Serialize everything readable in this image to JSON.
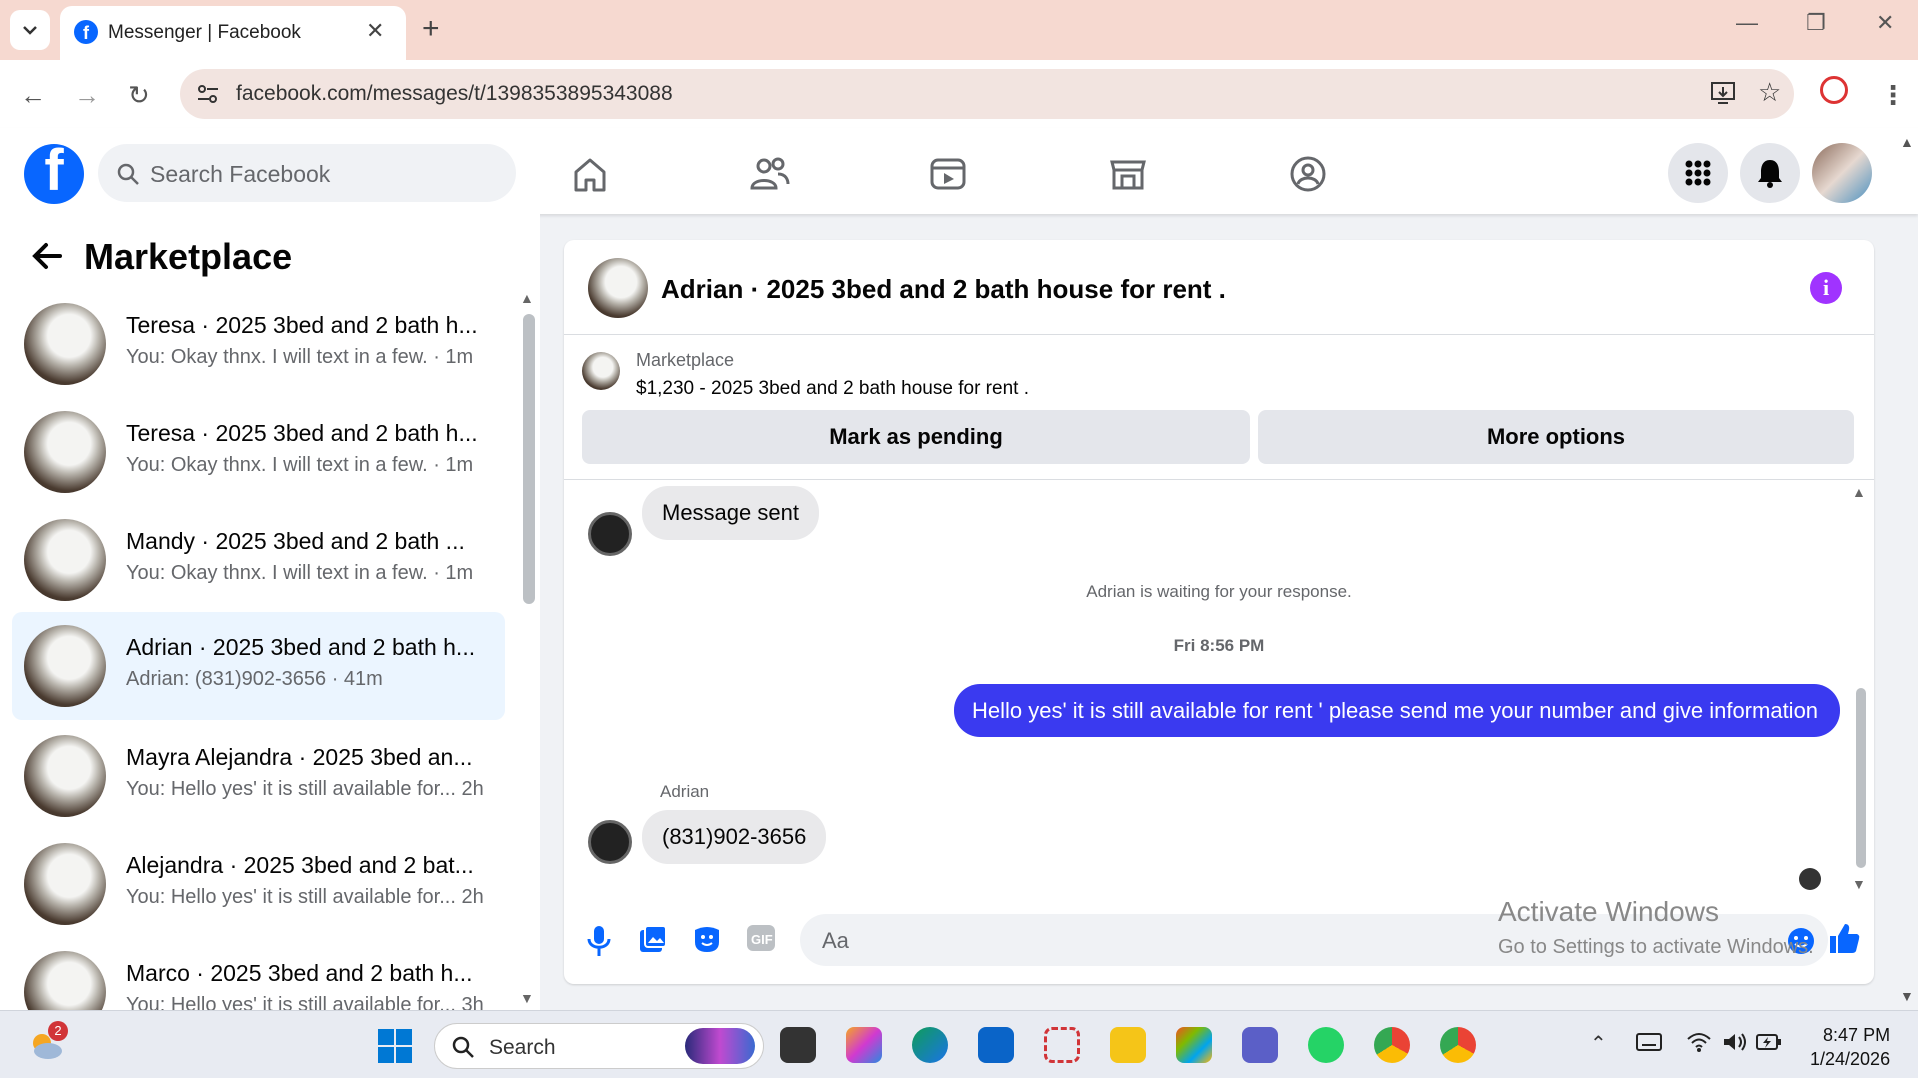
{
  "browser": {
    "tab_title": "Messenger | Facebook",
    "url": "facebook.com/messages/t/1398353895343088"
  },
  "facebook": {
    "search_placeholder": "Search Facebook",
    "brand_color": "#0866ff"
  },
  "sidebar": {
    "title": "Marketplace",
    "conversations": [
      {
        "name": "Teresa · 2025 3bed and 2 bath h...",
        "snippet": "You: Okay thnx. I will text in a few. · 1m"
      },
      {
        "name": "Teresa · 2025 3bed and 2 bath h...",
        "snippet": "You: Okay thnx. I will text in a few. · 1m"
      },
      {
        "name": "Mandy · 2025 3bed and 2 bath ...",
        "snippet": "You: Okay thnx. I will text in a few. · 1m"
      },
      {
        "name": "Adrian · 2025 3bed and 2 bath h...",
        "snippet": "Adrian: (831)902-3656 · 41m"
      },
      {
        "name": "Mayra Alejandra · 2025 3bed an...",
        "snippet": "You: Hello yes' it is still available for...  2h"
      },
      {
        "name": "Alejandra · 2025 3bed and 2 bat...",
        "snippet": "You: Hello yes' it is still available for...  2h"
      },
      {
        "name": "Marco · 2025 3bed and 2 bath h...",
        "snippet": "You: Hello yes' it is still available for...  3h"
      }
    ]
  },
  "chat": {
    "title": "Adrian · 2025 3bed and 2 bath house for rent .",
    "listing_label": "Marketplace",
    "listing_price_title": "$1,230 - 2025 3bed and 2 bath house for rent .",
    "mark_pending_label": "Mark as pending",
    "more_options_label": "More options",
    "msg_sent": "Message sent",
    "waiting_notice": "Adrian is waiting for your response.",
    "timestamp": "Fri 8:56 PM",
    "outgoing": "Hello yes' it is still available for rent ' please send me your number and give information",
    "sender_name": "Adrian",
    "incoming": "(831)902-3656",
    "input_placeholder": "Aa",
    "outgoing_color": "#3a3af0"
  },
  "watermark": {
    "line1": "Activate Windows",
    "line2": "Go to Settings to activate Windows."
  },
  "taskbar": {
    "search_label": "Search",
    "weather_badge": "2",
    "time": "8:47 PM",
    "date": "1/24/2026"
  }
}
